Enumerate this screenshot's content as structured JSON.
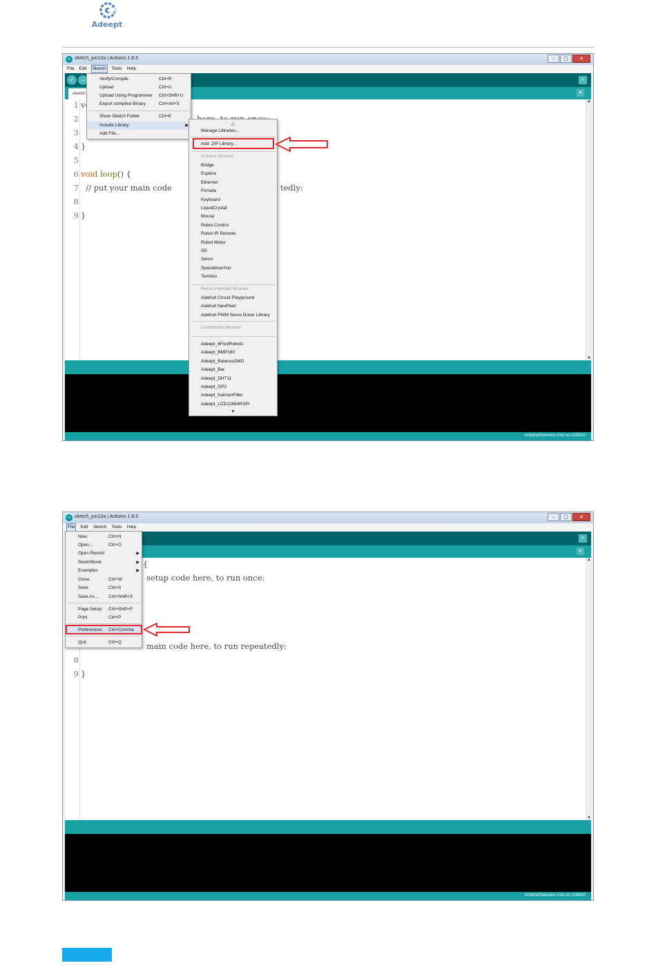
{
  "page": {
    "logo_text": "Adeept",
    "colors": {
      "teal": "#00979c",
      "teal_light": "#17a1a5",
      "toolbar_dark": "#006468",
      "highlight_red": "#e3242b",
      "footer_blue": "#17a9ee"
    }
  },
  "window1": {
    "title": "sketch_jun12a | Arduino 1.8.5",
    "menus": [
      "File",
      "Edit",
      "Sketch",
      "Tools",
      "Help"
    ],
    "open_menu": "Sketch",
    "tab_label": "sketch",
    "code": [
      {
        "num": "1",
        "text": "vo"
      },
      {
        "num": "2",
        "text": ""
      },
      {
        "num": "3",
        "text": ""
      },
      {
        "num": "4",
        "text": "}"
      },
      {
        "num": "5",
        "text": ""
      },
      {
        "num": "6",
        "kw": "void",
        "fn": "loop",
        "rest": "() {"
      },
      {
        "num": "7",
        "text": "  // put your main code"
      },
      {
        "num": "8",
        "text": ""
      },
      {
        "num": "9",
        "text": "}"
      }
    ],
    "code_behind_menu": [
      "here, to run once:",
      "tedly:"
    ],
    "board": "Arduino/Genuino Uno on COM10",
    "sketch_menu": [
      {
        "label": "Verify/Compile",
        "shortcut": "Ctrl+R"
      },
      {
        "label": "Upload",
        "shortcut": "Ctrl+U"
      },
      {
        "label": "Upload Using Programmer",
        "shortcut": "Ctrl+Shift+U"
      },
      {
        "label": "Export compiled Binary",
        "shortcut": "Ctrl+Alt+S"
      },
      {
        "label": "Show Sketch Folder",
        "shortcut": "Ctrl+K"
      },
      {
        "label": "Include Library",
        "shortcut": ""
      },
      {
        "label": "Add File...",
        "shortcut": ""
      }
    ],
    "library_menu": {
      "manage": "Manage Libraries...",
      "add_zip": "Add .ZIP Library...",
      "arduino_header": "Arduino libraries",
      "arduino_libs": [
        "Bridge",
        "Esplora",
        "Ethernet",
        "Firmata",
        "Keyboard",
        "LiquidCrystal",
        "Mouse",
        "Robot Control",
        "Robot IR Remote",
        "Robot Motor",
        "SD",
        "Servo",
        "SpacebrewYun",
        "Temboo"
      ],
      "recommended_header": "Recommended libraries",
      "recommended_libs": [
        "Adafruit Circuit Playground",
        "Adafruit NeoPixel",
        "Adafruit PWM Servo Driver Library"
      ],
      "contributed_header": "Contributed libraries",
      "contributed_libs": [
        "Adeept_6FootRobots",
        "Adeept_BMP180",
        "Adeept_Balance2WD",
        "Adeept_Bar",
        "Adeept_DHT11",
        "Adeept_GP2",
        "Adeept_KalmanFilter",
        "Adeept_LCD12864RSPI"
      ]
    }
  },
  "window2": {
    "title": "sketch_jun12a | Arduino 1.8.5",
    "menus": [
      "File",
      "Edit",
      "Sketch",
      "Tools",
      "Help"
    ],
    "open_menu": "File",
    "code_visible": [
      {
        "num": "",
        "text": "{"
      },
      {
        "num": "",
        "text": "setup code here, to run once:"
      },
      {
        "num": "",
        "text": "main code here, to run repeatedly:"
      },
      {
        "num": "8",
        "text": ""
      },
      {
        "num": "9",
        "text": "}"
      }
    ],
    "board": "Arduino/Genuino Uno on COM10",
    "file_menu": [
      {
        "label": "New",
        "shortcut": "Ctrl+N"
      },
      {
        "label": "Open...",
        "shortcut": "Ctrl+O"
      },
      {
        "label": "Open Recent",
        "shortcut": ""
      },
      {
        "label": "Sketchbook",
        "shortcut": ""
      },
      {
        "label": "Examples",
        "shortcut": ""
      },
      {
        "label": "Close",
        "shortcut": "Ctrl+W"
      },
      {
        "label": "Save",
        "shortcut": "Ctrl+S"
      },
      {
        "label": "Save As...",
        "shortcut": "Ctrl+Shift+S"
      },
      {
        "label": "Page Setup",
        "shortcut": "Ctrl+Shift+P"
      },
      {
        "label": "Print",
        "shortcut": "Ctrl+P"
      },
      {
        "label": "Preferences",
        "shortcut": "Ctrl+Comma"
      },
      {
        "label": "Quit",
        "shortcut": "Ctrl+Q"
      }
    ]
  }
}
